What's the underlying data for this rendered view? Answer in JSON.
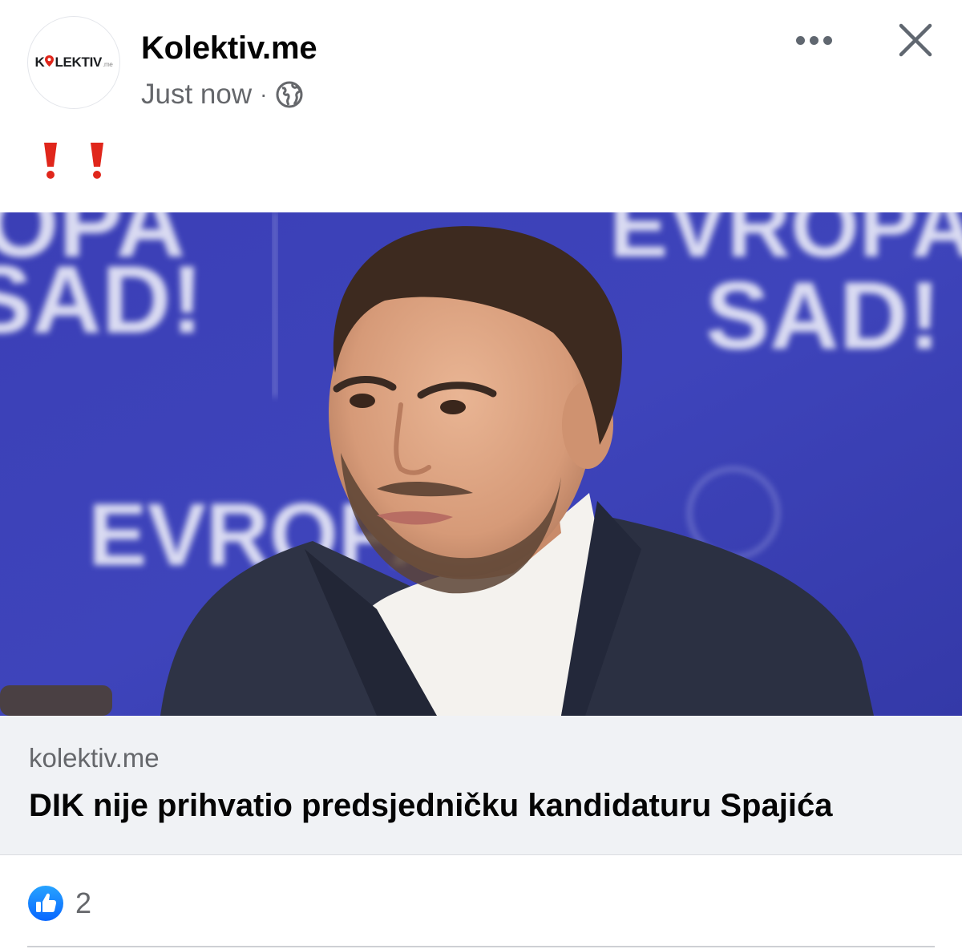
{
  "header": {
    "page_name": "Kolektiv.me",
    "timestamp": "Just now",
    "separator": "·",
    "privacy_icon": "globe-icon",
    "avatar": {
      "logo_text_left": "K",
      "logo_text_right": "LEKTIV",
      "logo_suffix": ".me"
    },
    "more_icon": "more-horizontal-icon",
    "close_icon": "close-icon"
  },
  "post": {
    "text_icons": [
      "exclamation-icon",
      "exclamation-icon"
    ]
  },
  "link_preview": {
    "domain": "kolektiv.me",
    "title": "DIK nije prihvatio predsjedničku kandidaturu Spajića",
    "image_text_left": "SAD!",
    "image_text_right_top": "EVROPA",
    "image_text_right_bottom": "SAD!",
    "image_text_lower_left": "EVROPA"
  },
  "reactions": {
    "icon": "like-icon",
    "count": "2"
  },
  "colors": {
    "accent": "#1877f2",
    "excl_red": "#e0261b",
    "backdrop_blue": "#3b41b4"
  }
}
